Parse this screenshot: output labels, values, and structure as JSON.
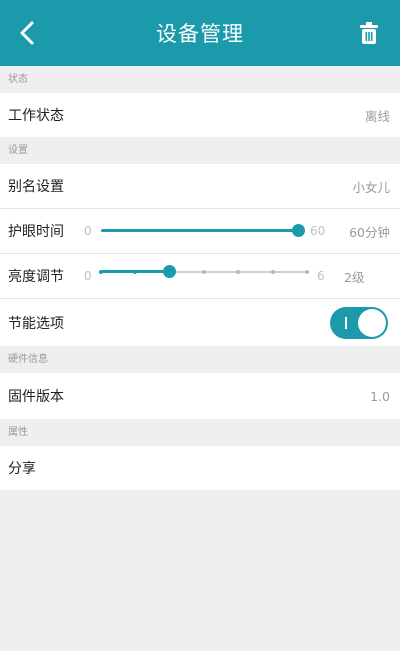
{
  "header": {
    "title": "设备管理",
    "back_icon": "chevron-left-icon",
    "delete_icon": "trash-icon"
  },
  "colors": {
    "accent": "#1b9aac",
    "background": "#efefef",
    "row": "#ffffff"
  },
  "sections": {
    "status": {
      "label": "状态",
      "work_status": {
        "label": "工作状态",
        "value": "离线"
      }
    },
    "settings": {
      "label": "设置",
      "alias": {
        "label": "别名设置",
        "value": "小女儿"
      },
      "eye_care": {
        "label": "护眼时间",
        "min": "0",
        "max": "60",
        "value": "60分钟",
        "level": 60,
        "range": [
          0,
          60
        ]
      },
      "brightness": {
        "label": "亮度调节",
        "min": "0",
        "max": "6",
        "value": "2级",
        "level": 2,
        "range": [
          0,
          6
        ]
      },
      "power_saving": {
        "label": "节能选项",
        "enabled": true
      }
    },
    "hardware": {
      "label": "硬件信息",
      "firmware": {
        "label": "固件版本",
        "value": "1.0"
      }
    },
    "properties": {
      "label": "属性",
      "share": {
        "label": "分享"
      }
    }
  }
}
